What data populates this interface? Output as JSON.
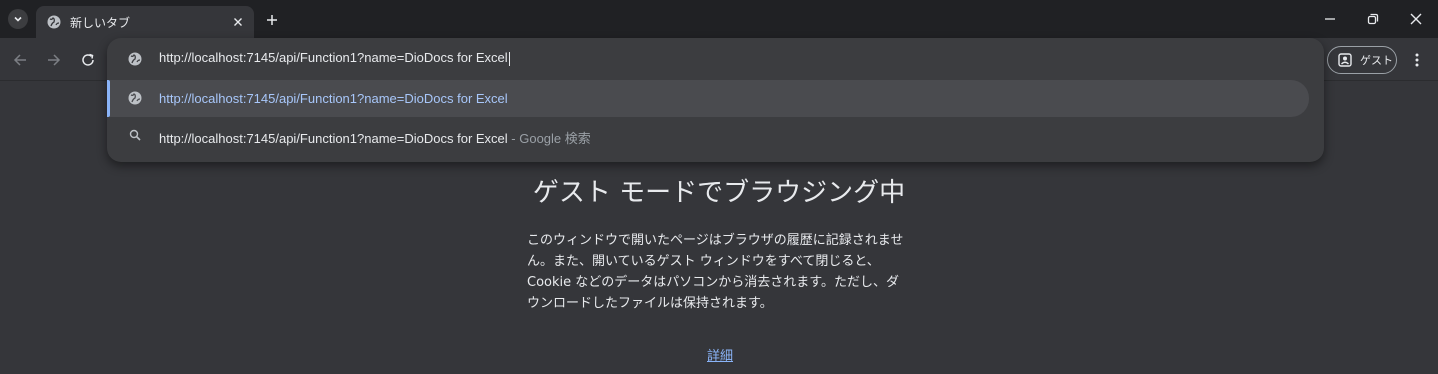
{
  "tab": {
    "title": "新しいタブ"
  },
  "omnibox": {
    "input_value": "http://localhost:7145/api/Function1?name=DioDocs for Excel",
    "suggestions": [
      {
        "text": "http://localhost:7145/api/Function1?name=DioDocs for Excel",
        "suffix": ""
      },
      {
        "text": "http://localhost:7145/api/Function1?name=DioDocs for Excel",
        "suffix": " - Google 検索"
      }
    ]
  },
  "profile": {
    "label": "ゲスト"
  },
  "guest_page": {
    "title": "ゲスト モードでブラウジング中",
    "description": "このウィンドウで開いたページはブラウザの履歴に記録されません。また、開いているゲスト ウィンドウをすべて閉じると、Cookie などのデータはパソコンから消去されます。ただし、ダウンロードしたファイルは保持されます。",
    "details_link": "詳細"
  },
  "colors": {
    "background": "#35363a",
    "tabstrip": "#202124",
    "omnibox": "#3c3d40",
    "accent": "#8ab4f8",
    "selected_text": "#a8c7fa"
  },
  "icons": [
    "tab-search-icon",
    "globe-icon",
    "close-icon",
    "plus-icon",
    "minimize-icon",
    "restore-icon",
    "back-icon",
    "forward-icon",
    "reload-icon",
    "search-icon",
    "profile-icon",
    "more-menu-icon"
  ]
}
